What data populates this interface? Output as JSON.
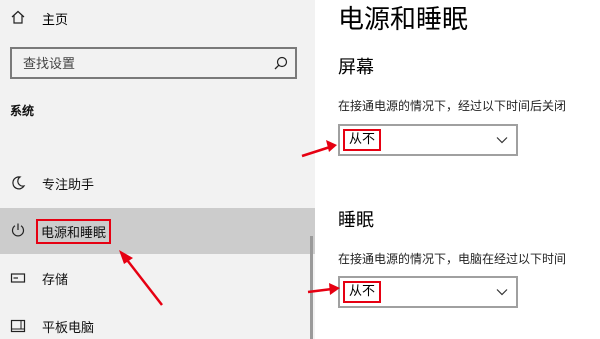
{
  "sidebar": {
    "home_label": "主页",
    "search_placeholder": "查找设置",
    "section_label": "系统",
    "items": [
      {
        "label": "专注助手",
        "icon": "moon-icon"
      },
      {
        "label": "电源和睡眠",
        "icon": "power-icon",
        "selected": true
      },
      {
        "label": "存储",
        "icon": "storage-icon"
      },
      {
        "label": "平板电脑",
        "icon": "tablet-icon"
      }
    ]
  },
  "main": {
    "title": "电源和睡眠",
    "screen": {
      "heading": "屏幕",
      "description": "在接通电源的情况下，经过以下时间后关闭",
      "value": "从不"
    },
    "sleep": {
      "heading": "睡眠",
      "description": "在接通电源的情况下，电脑在经过以下时间",
      "value": "从不"
    }
  },
  "colors": {
    "accent_annotation": "#e60012",
    "sidebar_bg": "#f2f2f2",
    "selected_bg": "#cccccc"
  }
}
